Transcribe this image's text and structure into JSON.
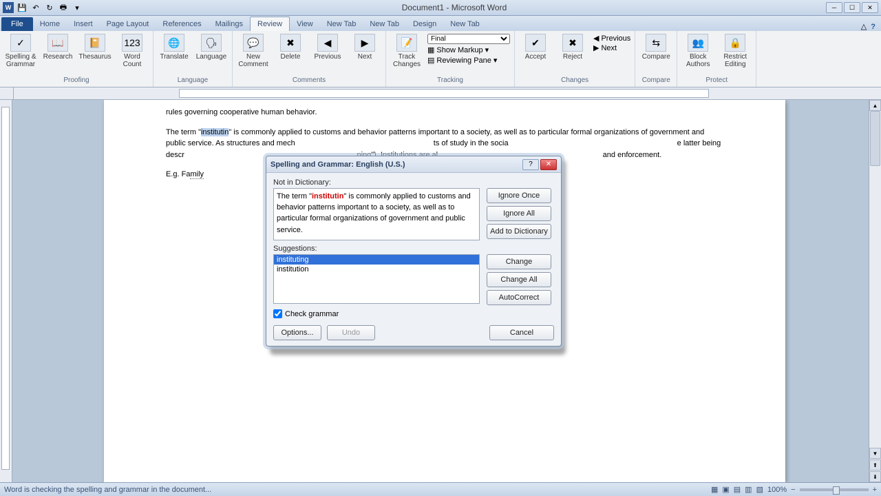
{
  "titlebar": {
    "title": "Document1 - Microsoft Word"
  },
  "tabs": {
    "file": "File",
    "home": "Home",
    "insert": "Insert",
    "page_layout": "Page Layout",
    "references": "References",
    "mailings": "Mailings",
    "review": "Review",
    "view": "View",
    "new_tab1": "New Tab",
    "new_tab2": "New Tab",
    "design": "Design",
    "new_tab3": "New Tab"
  },
  "ribbon": {
    "proofing": {
      "label": "Proofing",
      "spelling": "Spelling &\nGrammar",
      "research": "Research",
      "thesaurus": "Thesaurus",
      "word_count": "Word\nCount"
    },
    "language": {
      "label": "Language",
      "translate": "Translate",
      "language": "Language"
    },
    "comments": {
      "label": "Comments",
      "new_comment": "New\nComment",
      "delete": "Delete",
      "previous": "Previous",
      "next": "Next"
    },
    "tracking": {
      "label": "Tracking",
      "track_changes": "Track\nChanges",
      "display_select": "Final",
      "show_markup": "Show Markup",
      "reviewing_pane": "Reviewing Pane"
    },
    "changes": {
      "label": "Changes",
      "accept": "Accept",
      "reject": "Reject",
      "previous": "Previous",
      "next": "Next"
    },
    "compare": {
      "label": "Compare",
      "compare": "Compare"
    },
    "protect": {
      "label": "Protect",
      "block_authors": "Block\nAuthors",
      "restrict_editing": "Restrict\nEditing"
    }
  },
  "document": {
    "para1": "rules governing cooperative human behavior.",
    "para2_a": "The term \"",
    "para2_err": "institutin",
    "para2_b": "\" is commonly applied to customs and behavior patterns important to a society, as well as to particular formal organizations of government and public service. As structures and mech",
    "para2_c": "ts of study in the socia",
    "para2_d": "e latter being descr",
    "para2_e": "ning\"). Institutions are al",
    "para2_f": "and enforcement.",
    "para3": "E.g. Fa"
  },
  "dialog": {
    "title": "Spelling and Grammar: English (U.S.)",
    "not_in_dict_label": "Not in Dictionary:",
    "context_pre": "The term \"",
    "context_err": "institutin",
    "context_post": "\" is commonly applied to customs and behavior patterns important to a society, as well as to particular formal organizations of government and public service.",
    "suggestions_label": "Suggestions:",
    "suggestions": [
      "instituting",
      "institution"
    ],
    "check_grammar": "Check grammar",
    "buttons": {
      "ignore_once": "Ignore Once",
      "ignore_all": "Ignore All",
      "add_to_dictionary": "Add to Dictionary",
      "change": "Change",
      "change_all": "Change All",
      "autocorrect": "AutoCorrect",
      "options": "Options...",
      "undo": "Undo",
      "cancel": "Cancel"
    }
  },
  "statusbar": {
    "message": "Word is checking the spelling and grammar in the document...",
    "zoom": "100%"
  }
}
